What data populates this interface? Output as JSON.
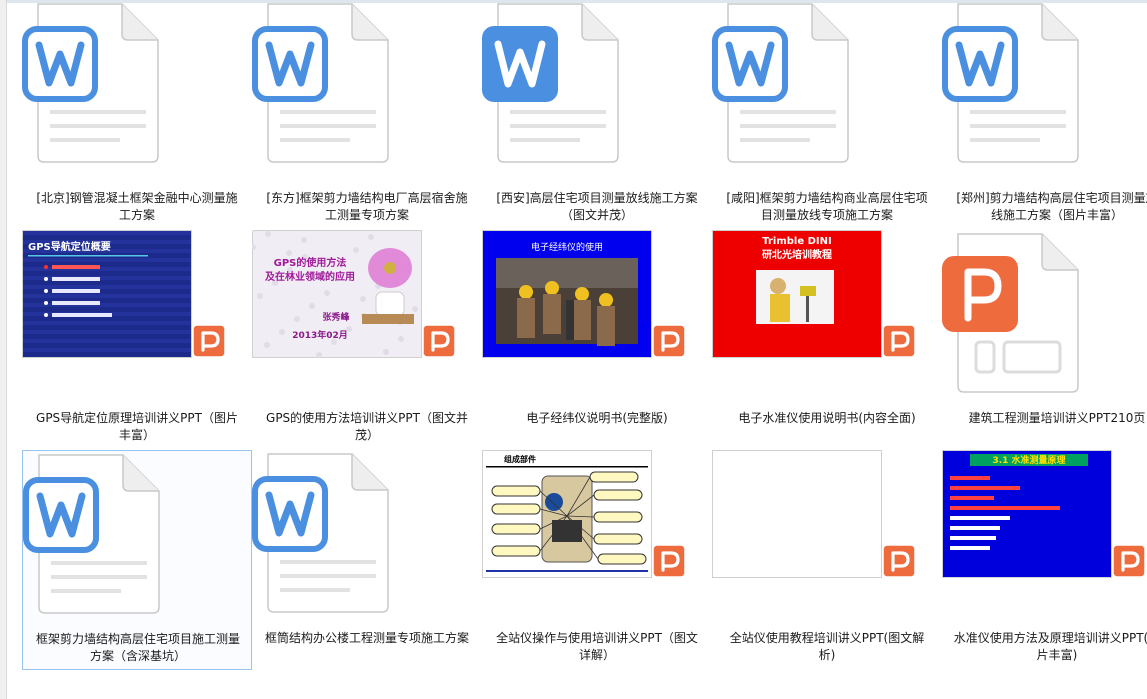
{
  "files": [
    {
      "label": "[北京]钢管混凝土框架金融中心测量施工方案",
      "kind": "word"
    },
    {
      "label": "[东方]框架剪力墙结构电厂高层宿舍施工测量专项方案",
      "kind": "word"
    },
    {
      "label": "[西安]高层住宅项目测量放线施工方案（图文并茂）",
      "kind": "word-solid"
    },
    {
      "label": "[咸阳]框架剪力墙结构商业高层住宅项目测量放线专项施工方案",
      "kind": "word"
    },
    {
      "label": "[郑州]剪力墙结构高层住宅项目测量放线施工方案（图片丰富）",
      "kind": "word"
    },
    {
      "label": "GPS导航定位原理培训讲义PPT（图片丰富）",
      "kind": "ppt-gps",
      "slide": {
        "title": "GPS导航定位概要"
      }
    },
    {
      "label": "GPS的使用方法培训讲义PPT（图文并茂）",
      "kind": "ppt-gps2",
      "slide": {
        "line1": "GPS的使用方法",
        "line2": "及在林业领域的应用",
        "author": "张秀峰",
        "date": "2013年02月"
      }
    },
    {
      "label": "电子经纬仪说明书(完整版)",
      "kind": "ppt-theo",
      "slide": {
        "title": "电子经纬仪的使用"
      }
    },
    {
      "label": "电子水准仪使用说明书(内容全面)",
      "kind": "ppt-level",
      "slide": {
        "line1": "Trimble DINI",
        "line2": "研北光培训教程"
      }
    },
    {
      "label": "建筑工程测量培训讲义PPT210页",
      "kind": "ppt-big"
    },
    {
      "label": "框架剪力墙结构高层住宅项目施工测量方案（含深基坑）",
      "kind": "word",
      "selected": true
    },
    {
      "label": "框筒结构办公楼工程测量专项施工方案",
      "kind": "word"
    },
    {
      "label": "全站仪操作与使用培训讲义PPT（图文详解）",
      "kind": "ppt-station",
      "slide": {
        "title": "组成部件"
      }
    },
    {
      "label": "全站仪使用教程培训讲义PPT(图文解析)",
      "kind": "ppt-blank"
    },
    {
      "label": "水准仪使用方法及原理培训讲义PPT(图片丰富)",
      "kind": "ppt-blue",
      "slide": {
        "title": "3.1 水准测量原理"
      }
    }
  ],
  "colors": {
    "word": "#4a8fe0",
    "ppt": "#ee6b3e",
    "paper": "#ffffff",
    "paperBorder": "#c9c9c9",
    "selectBorder": "#99c4ee"
  }
}
